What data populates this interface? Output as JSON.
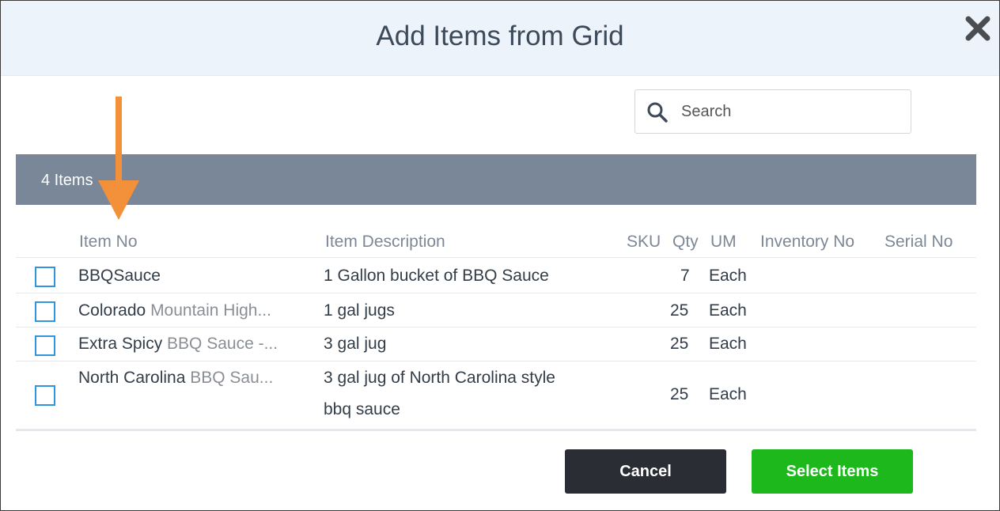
{
  "dialog": {
    "title": "Add Items from Grid",
    "close_icon": "close-x-icon"
  },
  "search": {
    "placeholder": "Search",
    "icon": "search-icon"
  },
  "grid": {
    "count_label": "4 Items",
    "columns": [
      "Item No",
      "Item Description",
      "SKU",
      "Qty",
      "UM",
      "Inventory No",
      "Serial No"
    ],
    "rows": [
      {
        "item_no": "BBQSauce",
        "item_no_muted": "",
        "description_line1": "1 Gallon bucket of BBQ Sauce",
        "description_line2": "",
        "sku": "",
        "qty": "7",
        "um": "Each",
        "checked": false
      },
      {
        "item_no": "Colorado ",
        "item_no_muted": "Mountain High...",
        "description_line1": "1 gal jugs",
        "description_line2": "",
        "sku": "",
        "qty": "25",
        "um": "Each",
        "checked": false
      },
      {
        "item_no": "Extra Spicy ",
        "item_no_muted": "BBQ Sauce -...",
        "description_line1": "3 gal jug",
        "description_line2": "",
        "sku": "",
        "qty": "25",
        "um": "Each",
        "checked": false
      },
      {
        "item_no": "North Carolina ",
        "item_no_muted": "BBQ Sau...",
        "description_line1": "3 gal jug of North Carolina style",
        "description_line2": "bbq sauce",
        "sku": "",
        "qty": "25",
        "um": "Each",
        "checked": false
      }
    ]
  },
  "footer": {
    "cancel_label": "Cancel",
    "select_label": "Select Items"
  },
  "annotation": {
    "arrow_color": "#f3913b"
  },
  "colors": {
    "header_bg": "#edf3fa",
    "count_bar": "#7a8799",
    "checkbox_border": "#2f96dd",
    "cancel_bg": "#2a2d33",
    "select_bg": "#1cb81c"
  }
}
